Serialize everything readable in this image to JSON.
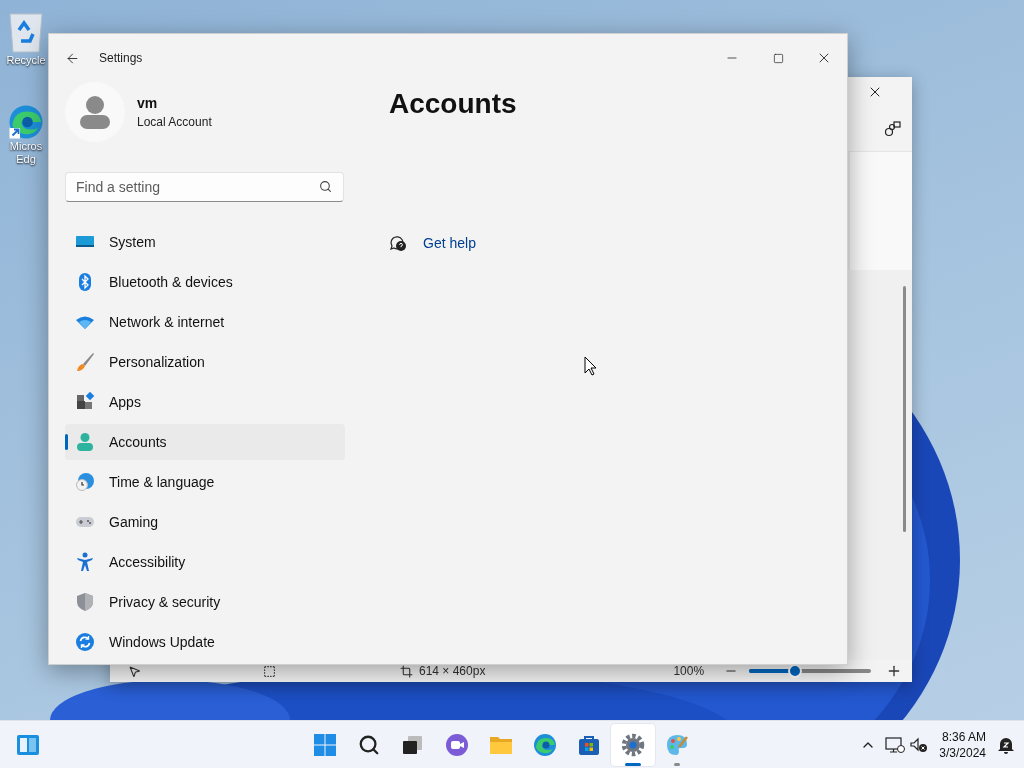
{
  "desktop_icons": [
    {
      "kind": "recycle",
      "lines": [
        "Recycle"
      ]
    },
    {
      "kind": "edge",
      "lines": [
        "Micros",
        "Edg"
      ]
    }
  ],
  "back_window": {
    "status_bar": {
      "dimensions": "614 × 460px",
      "zoom": "100%",
      "zoom_slider": {
        "level": 0.38
      }
    }
  },
  "settings": {
    "window": {
      "title": "Settings"
    },
    "profile": {
      "name": "vm",
      "account_type": "Local Account"
    },
    "search": {
      "placeholder": "Find a setting"
    },
    "nav": [
      {
        "kind": "system",
        "label": "System",
        "selected": false
      },
      {
        "kind": "bluetooth",
        "label": "Bluetooth & devices",
        "selected": false
      },
      {
        "kind": "network",
        "label": "Network & internet",
        "selected": false
      },
      {
        "kind": "personalization",
        "label": "Personalization",
        "selected": false
      },
      {
        "kind": "apps",
        "label": "Apps",
        "selected": false
      },
      {
        "kind": "accounts",
        "label": "Accounts",
        "selected": true
      },
      {
        "kind": "time",
        "label": "Time & language",
        "selected": false
      },
      {
        "kind": "gaming",
        "label": "Gaming",
        "selected": false
      },
      {
        "kind": "accessibility",
        "label": "Accessibility",
        "selected": false
      },
      {
        "kind": "privacy",
        "label": "Privacy & security",
        "selected": false
      },
      {
        "kind": "update",
        "label": "Windows Update",
        "selected": false
      }
    ],
    "page": {
      "title": "Accounts",
      "help_link": "Get help"
    }
  },
  "taskbar": {
    "apps": [
      {
        "kind": "start",
        "running": false,
        "active": false
      },
      {
        "kind": "search",
        "running": false,
        "active": false
      },
      {
        "kind": "taskview",
        "running": false,
        "active": false
      },
      {
        "kind": "chat",
        "running": false,
        "active": false
      },
      {
        "kind": "explorer",
        "running": false,
        "active": false
      },
      {
        "kind": "edge",
        "running": false,
        "active": false
      },
      {
        "kind": "store",
        "running": false,
        "active": false
      },
      {
        "kind": "settings",
        "running": true,
        "active": true
      },
      {
        "kind": "paint",
        "running": true,
        "active": false
      }
    ],
    "time": "8:36 AM",
    "date": "3/3/2024"
  }
}
